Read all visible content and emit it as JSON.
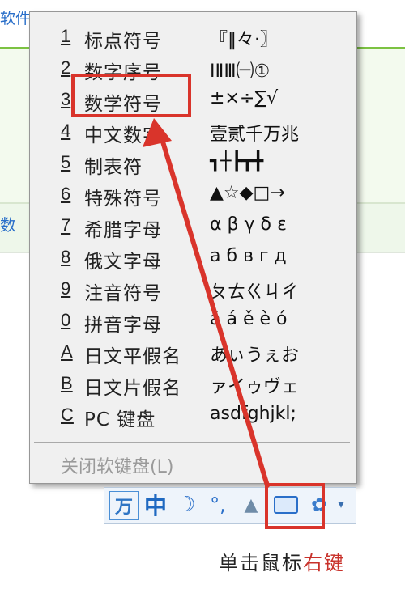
{
  "background": {
    "top_link": "软件",
    "tab_fragment": "数"
  },
  "menu": {
    "items": [
      {
        "key": "1",
        "label": "标点符号",
        "preview": "『‖々·〗"
      },
      {
        "key": "2",
        "label": "数字序号",
        "preview": "ⅠⅡⅢ㈠①"
      },
      {
        "key": "3",
        "label": "数学符号",
        "preview": "±×÷∑√"
      },
      {
        "key": "4",
        "label": "中文数字",
        "preview": "壹贰千万兆"
      },
      {
        "key": "5",
        "label": "制表符",
        "preview": "┓┼┣┳╋"
      },
      {
        "key": "6",
        "label": "特殊符号",
        "preview": "▲☆◆□→"
      },
      {
        "key": "7",
        "label": "希腊字母",
        "preview": "α β γ δ ε"
      },
      {
        "key": "8",
        "label": "俄文字母",
        "preview": "а б в г д"
      },
      {
        "key": "9",
        "label": "注音符号",
        "preview": "ㄆㄊㄍㄐㄔ"
      },
      {
        "key": "0",
        "label": "拼音字母",
        "preview": "ā á ě è ó"
      },
      {
        "key": "A",
        "label": "日文平假名",
        "preview": "あぃうぇお"
      },
      {
        "key": "B",
        "label": "日文片假名",
        "preview": "ァイゥヴェ"
      },
      {
        "key": "C",
        "label": "PC 键盘",
        "preview": "asdfghjkl;"
      }
    ],
    "close_label": "关闭软键盘",
    "close_key": "(L)"
  },
  "ime_toolbar": {
    "wubi_glyph": "万",
    "mode_glyph": "中",
    "moon_glyph": "☽",
    "punct_glyph": "°,",
    "user_glyph": "▲",
    "gear_glyph": "✿",
    "drop_glyph": "▾"
  },
  "caption": {
    "prefix": "单击鼠标",
    "highlight": "右键"
  },
  "colors": {
    "annotation": "#d9342b",
    "ime_blue": "#2a6fc9"
  }
}
